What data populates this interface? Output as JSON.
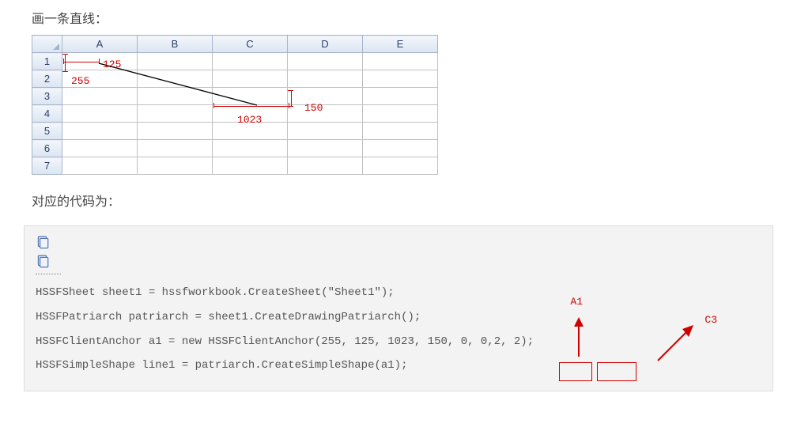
{
  "heading1": "画一条直线：",
  "heading2": "对应的代码为：",
  "spreadsheet": {
    "cols": [
      "A",
      "B",
      "C",
      "D",
      "E"
    ],
    "rows": [
      "1",
      "2",
      "3",
      "4",
      "5",
      "6",
      "7"
    ]
  },
  "annotations": {
    "v125": "125",
    "v255": "255",
    "v1023": "1023",
    "v150": "150",
    "a1": "A1",
    "c3": "C3"
  },
  "code": {
    "l1": "HSSFSheet sheet1 = hssfworkbook.CreateSheet(\"Sheet1\");",
    "l2": "HSSFPatriarch patriarch = sheet1.CreateDrawingPatriarch();",
    "l3": "HSSFClientAnchor a1 = new HSSFClientAnchor(255, 125, 1023, 150, 0, 0,2, 2);",
    "l4": "HSSFSimpleShape line1 = patriarch.CreateSimpleShape(a1);"
  }
}
